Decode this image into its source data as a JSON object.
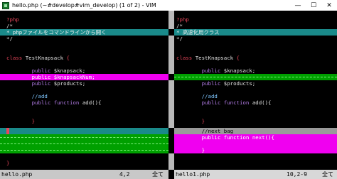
{
  "window": {
    "title": "hello.php (~#develop#vim_develop) (1 of 2) - VIM",
    "controls": {
      "minimize": "—",
      "maximize": "☐",
      "close": "✕"
    }
  },
  "left_pane": {
    "lines": {
      "php_open": "?php",
      "doc_open": "/*",
      "doc_text": "* phpファイルをコマンドラインから開く",
      "doc_close": "*/",
      "class_kw": "class",
      "class_name": " TestKnapsack ",
      "brace_open": "{",
      "prop1_mod": "public",
      "prop1_name": " $knapsack;",
      "prop2_mod": "public",
      "prop2_name": " $knapsackNum;",
      "prop3_mod": "public",
      "prop3_name": " $products;",
      "comment_add": "//add",
      "fn_mod": "public",
      "fn_kw": " function ",
      "fn_name": "add(){",
      "fn_close": "}",
      "class_close": "}"
    }
  },
  "right_pane": {
    "lines": {
      "php_open": "?php",
      "doc_open": "/*",
      "doc_text": "* 高速化用クラス",
      "doc_close": "*/",
      "class_kw": "class",
      "class_name": " TestKnapsack ",
      "brace_open": "{",
      "prop1_mod": "public",
      "prop1_name": " $knapsack;",
      "prop3_mod": "public",
      "prop3_name": " $products;",
      "comment_add": "//add",
      "fn_mod": "public",
      "fn_kw": " function ",
      "fn_name": "add(){",
      "fn_close": "}",
      "comment_next": "//next bag",
      "fn2_mod": "public",
      "fn2_kw": " function ",
      "fn2_name": "next(){",
      "fn2_close": "}"
    }
  },
  "statusline": {
    "left": {
      "filename": "hello.php",
      "position": "4,2",
      "scroll": "全て"
    },
    "right": {
      "filename": "hello1.php",
      "position": "10,2-9",
      "scroll": "全て"
    }
  },
  "colors": {
    "diff_change": "#1a8a8a",
    "diff_delete": "#f000f0",
    "diff_add": "#00a000",
    "keyword": "#b07be4",
    "type": "#e8455a"
  }
}
